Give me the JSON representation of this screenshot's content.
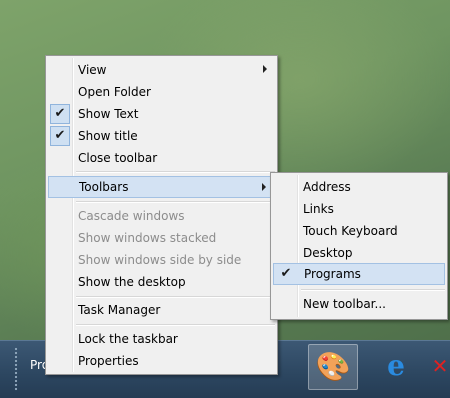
{
  "taskbar": {
    "partial_label": "Prog",
    "buttons": [
      {
        "name": "paint-icon",
        "glyph": "🎨"
      },
      {
        "name": "internet-explorer-icon",
        "glyph": "e"
      },
      {
        "name": "app-icon",
        "glyph": "✕"
      }
    ]
  },
  "context_menu": {
    "view": "View",
    "open_folder": "Open Folder",
    "show_text": "Show Text",
    "show_title": "Show title",
    "close_toolbar": "Close toolbar",
    "toolbars": "Toolbars",
    "cascade": "Cascade windows",
    "stacked": "Show windows stacked",
    "side_by_side": "Show windows side by side",
    "show_desktop": "Show the desktop",
    "task_manager": "Task Manager",
    "lock": "Lock the taskbar",
    "properties": "Properties",
    "check_mark": "✔"
  },
  "toolbars_submenu": {
    "address": "Address",
    "links": "Links",
    "touch_keyboard": "Touch Keyboard",
    "desktop": "Desktop",
    "programs": "Programs",
    "new_toolbar": "New toolbar..."
  }
}
